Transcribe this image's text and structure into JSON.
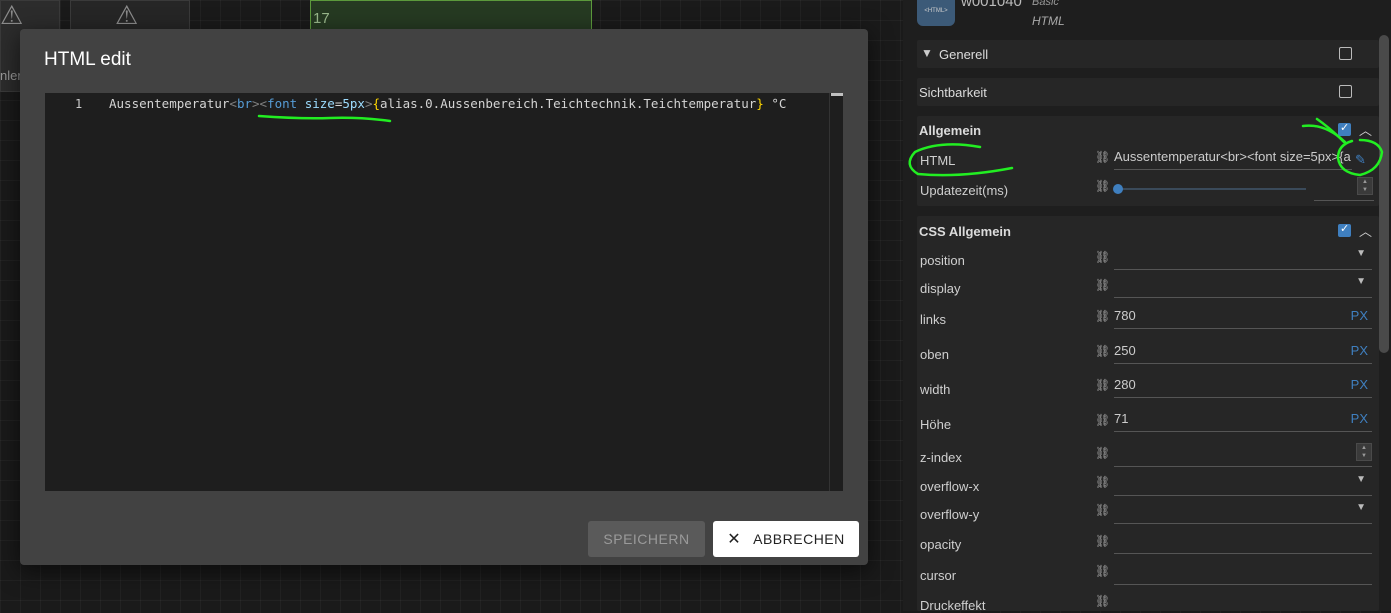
{
  "canvas": {
    "widget_number": "17",
    "partial_label": "nler"
  },
  "widget_header": {
    "icon_text": "<HTML>",
    "id": "w001040",
    "set": "Basic",
    "type": "HTML"
  },
  "groups": {
    "generell": "Generell",
    "sichtbarkeit": "Sichtbarkeit",
    "allgemein": "Allgemein",
    "css_allgemein": "CSS Allgemein"
  },
  "allgemein_rows": {
    "html_label": "HTML",
    "html_value": "Aussentemperatur<br><font size=5px>{a",
    "update_label": "Updatezeit(ms)"
  },
  "css_rows": [
    {
      "label": "position",
      "value": "",
      "unit": ""
    },
    {
      "label": "display",
      "value": "",
      "unit": ""
    },
    {
      "label": "links",
      "value": "780",
      "unit": "PX"
    },
    {
      "label": "oben",
      "value": "250",
      "unit": "PX"
    },
    {
      "label": "width",
      "value": "280",
      "unit": "PX"
    },
    {
      "label": "Höhe",
      "value": "71",
      "unit": "PX"
    },
    {
      "label": "z-index",
      "value": "",
      "unit": ""
    },
    {
      "label": "overflow-x",
      "value": "",
      "unit": ""
    },
    {
      "label": "overflow-y",
      "value": "",
      "unit": ""
    },
    {
      "label": "opacity",
      "value": "",
      "unit": ""
    },
    {
      "label": "cursor",
      "value": "",
      "unit": ""
    },
    {
      "label": "Druckeffekt",
      "value": "",
      "unit": ""
    }
  ],
  "dialog": {
    "title": "HTML edit",
    "line_number": "1",
    "code": {
      "text_before": "Aussentemperatur",
      "lt1": "<",
      "br": "br",
      "gt1": ">",
      "lt2": "<",
      "font": "font",
      "attr": "size",
      "eq": "=",
      "attr_value": "5px",
      "gt2": ">",
      "lbrace": "{",
      "binding": "alias.0.Aussenbereich.Teichtechnik.Teichtemperatur",
      "rbrace": "}",
      "text_after": " °C"
    },
    "save_label": "SPEICHERN",
    "cancel_label": "ABBRECHEN"
  },
  "colors": {
    "accent": "#3f7fbf",
    "annotation": "#22ee22"
  }
}
